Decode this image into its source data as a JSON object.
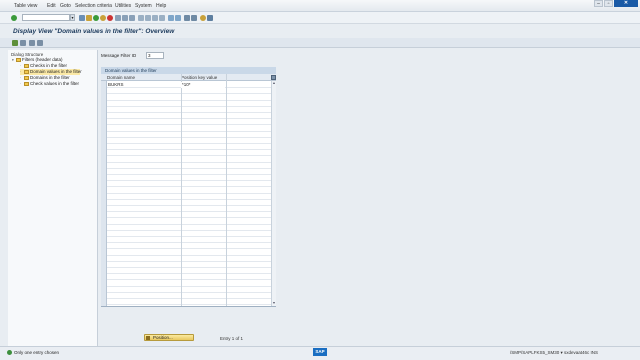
{
  "menubar": {
    "items": [
      "Table view",
      "Edit",
      "Goto",
      "Selection criteria",
      "Utilities",
      "System",
      "Help"
    ]
  },
  "window": {
    "title": "Display View \"Domain values in the filter\": Overview"
  },
  "dialog_structure": {
    "title": "Dialog Structure",
    "items": [
      {
        "label": "Filters (header data)",
        "level": 0,
        "selected": false
      },
      {
        "label": "Checks in the filter",
        "level": 1,
        "selected": false
      },
      {
        "label": "Domain values in the filter",
        "level": 1,
        "selected": true
      },
      {
        "label": "Domains in the filter",
        "level": 1,
        "selected": false
      },
      {
        "label": "Check values in the filter",
        "level": 1,
        "selected": false
      }
    ]
  },
  "filter": {
    "label": "Message Filter ID",
    "value": "3"
  },
  "table": {
    "caption": "Domain values in the filter",
    "columns": [
      "Domain name",
      "Position key value"
    ],
    "rows": [
      {
        "domain": "BUKRS",
        "key": "*10*"
      }
    ]
  },
  "footer": {
    "position_button": "Position...",
    "entry_text": "Entry 1 of 1"
  },
  "status": {
    "message": "Only one entry chosen",
    "system": "/SMP/SAPLFKS5_SM30 ▾ sxdevaat46c INS"
  },
  "colors": {
    "accent": "#1a5aa6",
    "selected_row": "#fbe9a6",
    "caption_bg": "#c9d8e8"
  }
}
